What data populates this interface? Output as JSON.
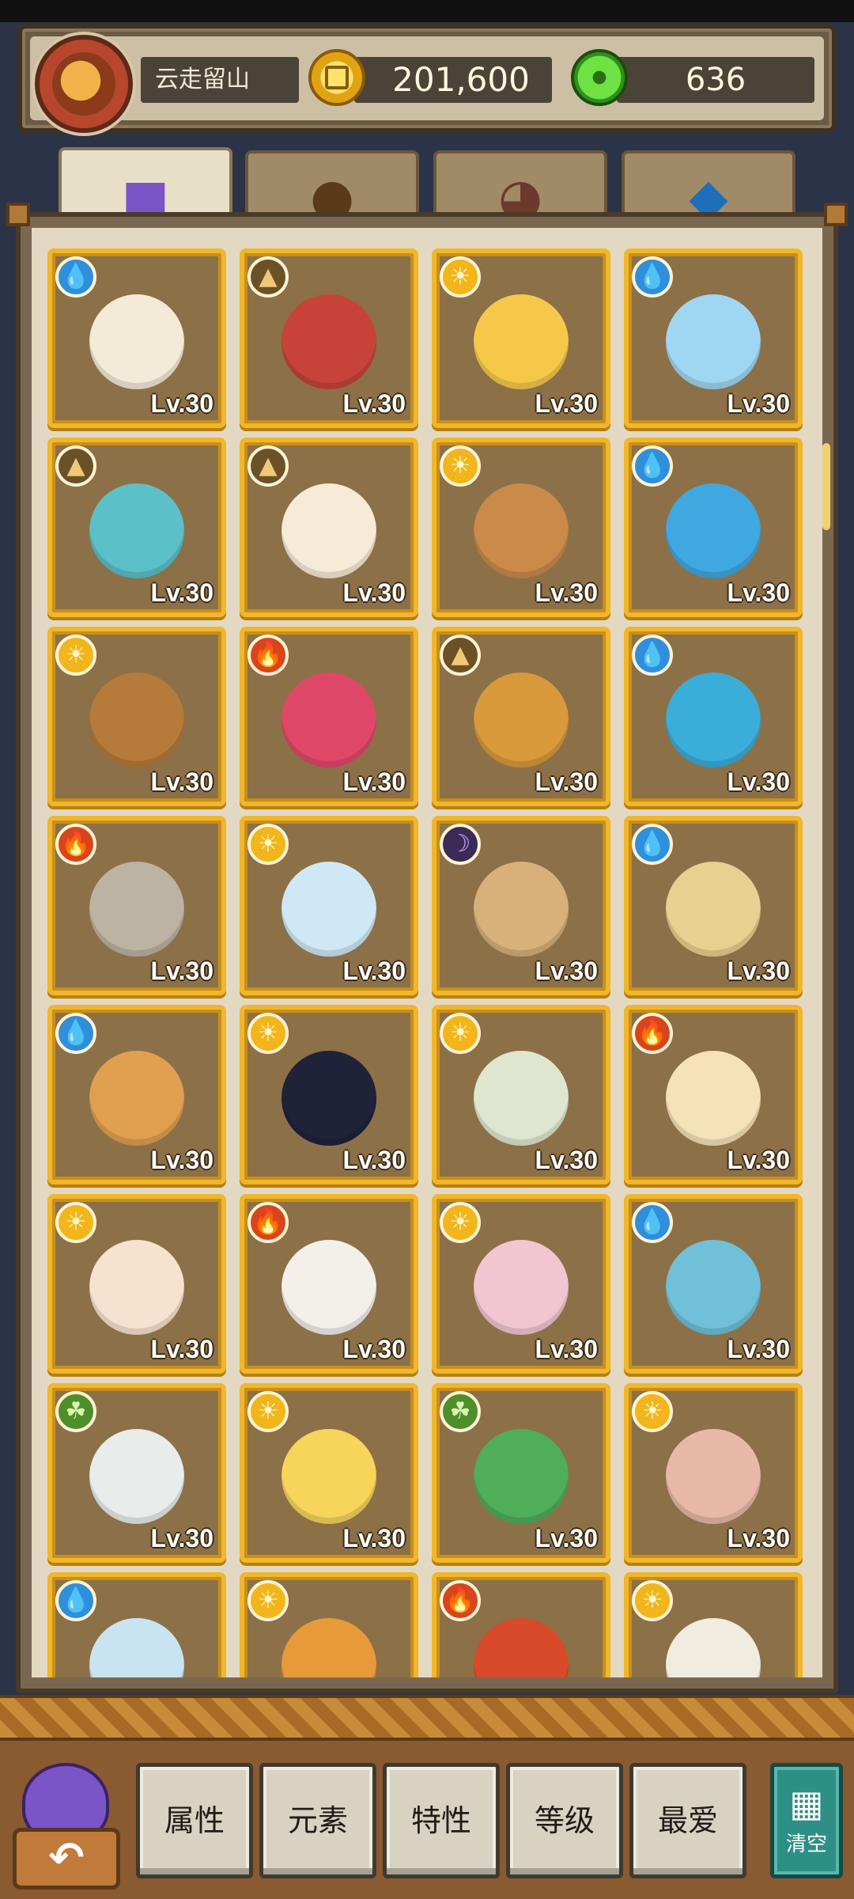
{
  "header": {
    "player_name": "云走留山",
    "coins": "201,600",
    "gems": "636"
  },
  "tabs": [
    {
      "icon": "monster-icon",
      "active": true
    },
    {
      "icon": "item-bag-icon",
      "active": false
    },
    {
      "icon": "food-bowl-icon",
      "active": false
    },
    {
      "icon": "crystal-icon",
      "active": false
    }
  ],
  "cards": [
    {
      "element": "water",
      "level": "Lv.30"
    },
    {
      "element": "earth",
      "level": "Lv.30"
    },
    {
      "element": "light",
      "level": "Lv.30"
    },
    {
      "element": "water",
      "level": "Lv.30"
    },
    {
      "element": "earth",
      "level": "Lv.30"
    },
    {
      "element": "earth",
      "level": "Lv.30"
    },
    {
      "element": "light",
      "level": "Lv.30"
    },
    {
      "element": "water",
      "level": "Lv.30"
    },
    {
      "element": "light",
      "level": "Lv.30"
    },
    {
      "element": "fire",
      "level": "Lv.30"
    },
    {
      "element": "earth",
      "level": "Lv.30"
    },
    {
      "element": "water",
      "level": "Lv.30"
    },
    {
      "element": "fire",
      "level": "Lv.30"
    },
    {
      "element": "light",
      "level": "Lv.30"
    },
    {
      "element": "dark",
      "level": "Lv.30"
    },
    {
      "element": "water",
      "level": "Lv.30"
    },
    {
      "element": "water",
      "level": "Lv.30"
    },
    {
      "element": "light",
      "level": "Lv.30"
    },
    {
      "element": "light",
      "level": "Lv.30"
    },
    {
      "element": "fire",
      "level": "Lv.30"
    },
    {
      "element": "light",
      "level": "Lv.30"
    },
    {
      "element": "fire",
      "level": "Lv.30"
    },
    {
      "element": "light",
      "level": "Lv.30"
    },
    {
      "element": "water",
      "level": "Lv.30"
    },
    {
      "element": "nature",
      "level": "Lv.30"
    },
    {
      "element": "light",
      "level": "Lv.30"
    },
    {
      "element": "nature",
      "level": "Lv.30"
    },
    {
      "element": "light",
      "level": "Lv.30"
    },
    {
      "element": "water",
      "level": ""
    },
    {
      "element": "light",
      "level": ""
    },
    {
      "element": "fire",
      "level": ""
    },
    {
      "element": "light",
      "level": ""
    }
  ],
  "filters": {
    "attribute": "属性",
    "element": "元素",
    "trait": "特性",
    "level": "等级",
    "favorite": "最爱",
    "clear": "清空"
  },
  "colors": {
    "card_border": "#f1b62a",
    "panel_bg": "#e3d9c3",
    "clear_button": "#2e8f86"
  }
}
